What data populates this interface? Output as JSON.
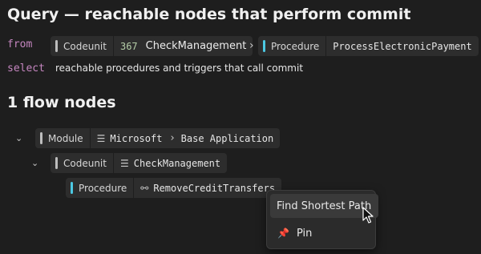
{
  "header": {
    "title": "Query — reachable nodes that perform commit"
  },
  "query": {
    "from_keyword": "from",
    "select_keyword": "select",
    "from_chips": [
      {
        "kind": "Codeunit",
        "number": "367",
        "name": "CheckManagement"
      },
      {
        "kind": "Procedure",
        "name": "ProcessElectronicPayment"
      }
    ],
    "select_text": "reachable procedures and triggers that call commit"
  },
  "results": {
    "heading": "1 flow nodes",
    "tree": {
      "module": {
        "kind": "Module",
        "publisher": "Microsoft",
        "app": "Base Application"
      },
      "codeunit": {
        "kind": "Codeunit",
        "name": "CheckManagement"
      },
      "procedure": {
        "kind": "Procedure",
        "name": "RemoveCreditTransfers"
      }
    }
  },
  "context_menu": {
    "items": [
      {
        "label": "Find Shortest Path",
        "icon": ""
      },
      {
        "label": "Pin",
        "icon": "pin-icon"
      }
    ]
  },
  "colors": {
    "background": "#1e1e1e",
    "keyword": "#c586c0",
    "codeunit_bar": "#bdbdbd",
    "procedure_bar": "#4cc9e3"
  }
}
